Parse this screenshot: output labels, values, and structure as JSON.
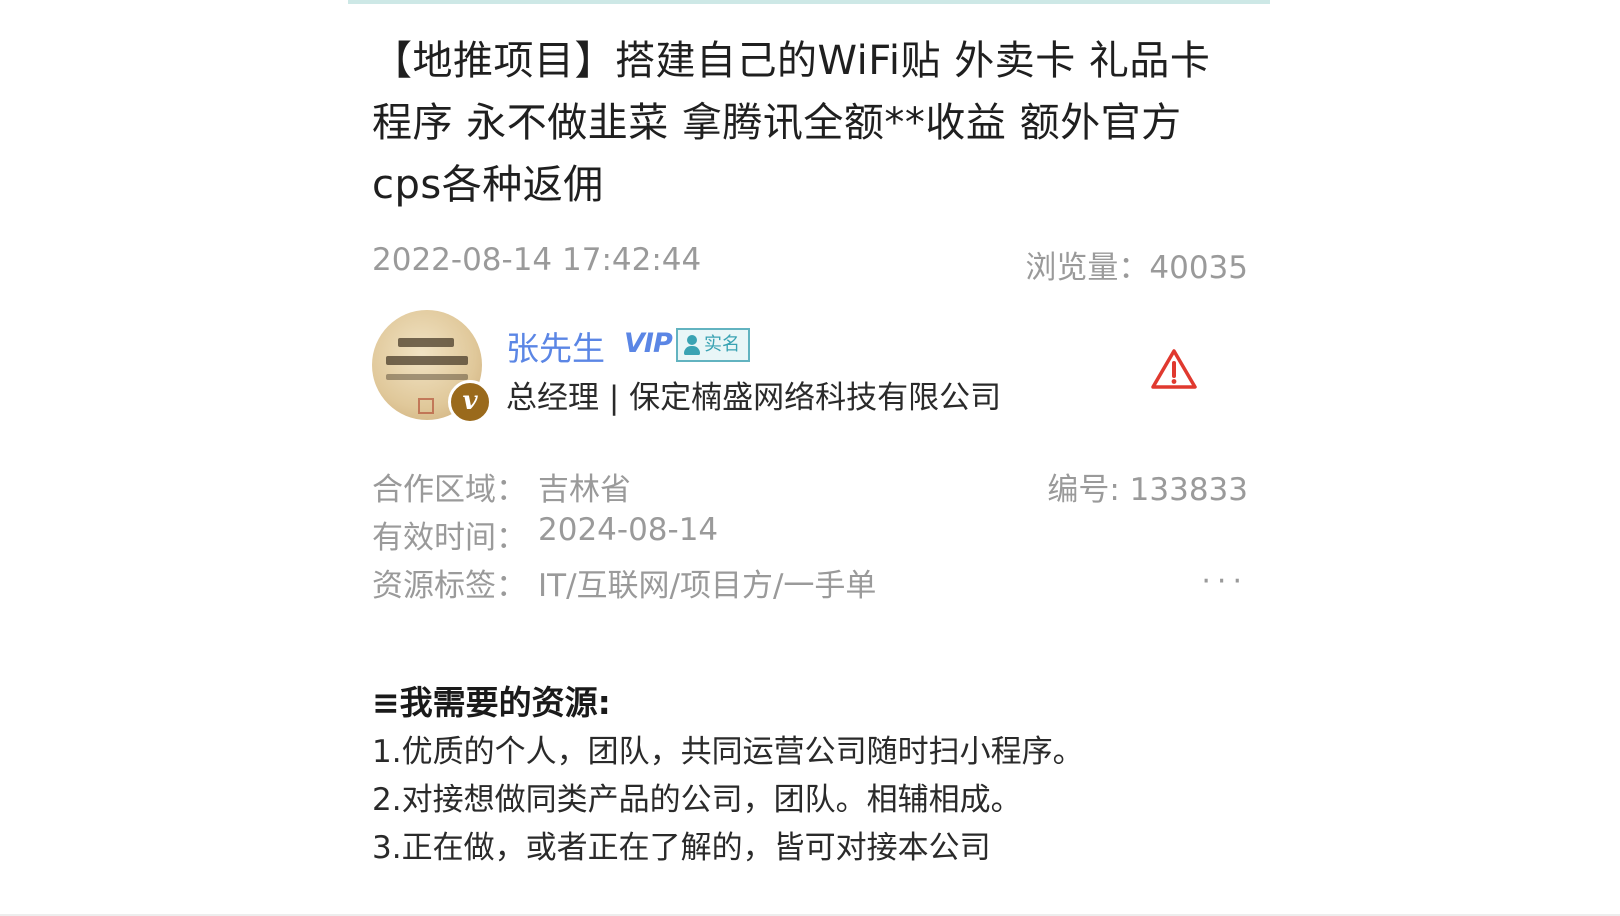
{
  "post": {
    "title": "【地推项目】搭建自己的WiFi贴 外卖卡 礼品卡程序 永不做韭菜 拿腾讯全额**收益 额外官方cps各种返佣",
    "date": "2022-08-14 17:42:44",
    "views": "浏览量：40035"
  },
  "author": {
    "name": "张先生",
    "vip_label": "VIP",
    "realname_label": "实名",
    "badge_letter": "v",
    "company": "总经理 | 保定楠盛网络科技有限公司"
  },
  "info": {
    "region_label": "合作区域：",
    "region_value": "吉林省",
    "id_text": "编号: 133833",
    "valid_label": "有效时间：",
    "valid_value": "2024-08-14",
    "tags_label": "资源标签：",
    "tags_value": "IT/互联网/项目方/一手单",
    "more": "···"
  },
  "needs": {
    "heading": "≡我需要的资源:",
    "lines": [
      "1.优质的个人，团队，共同运营公司随时扫小程序。",
      "2.对接想做同类产品的公司，团队。相辅相成。",
      "3.正在做，或者正在了解的，皆可对接本公司"
    ]
  },
  "colors": {
    "accent": "#5b86e5",
    "verified": "#3aa3b3",
    "warning": "#e0392f",
    "muted": "#9a9a9a"
  },
  "icons": {
    "report": "warning-triangle-icon",
    "more": "more-dots-icon",
    "verified": "person-icon"
  }
}
